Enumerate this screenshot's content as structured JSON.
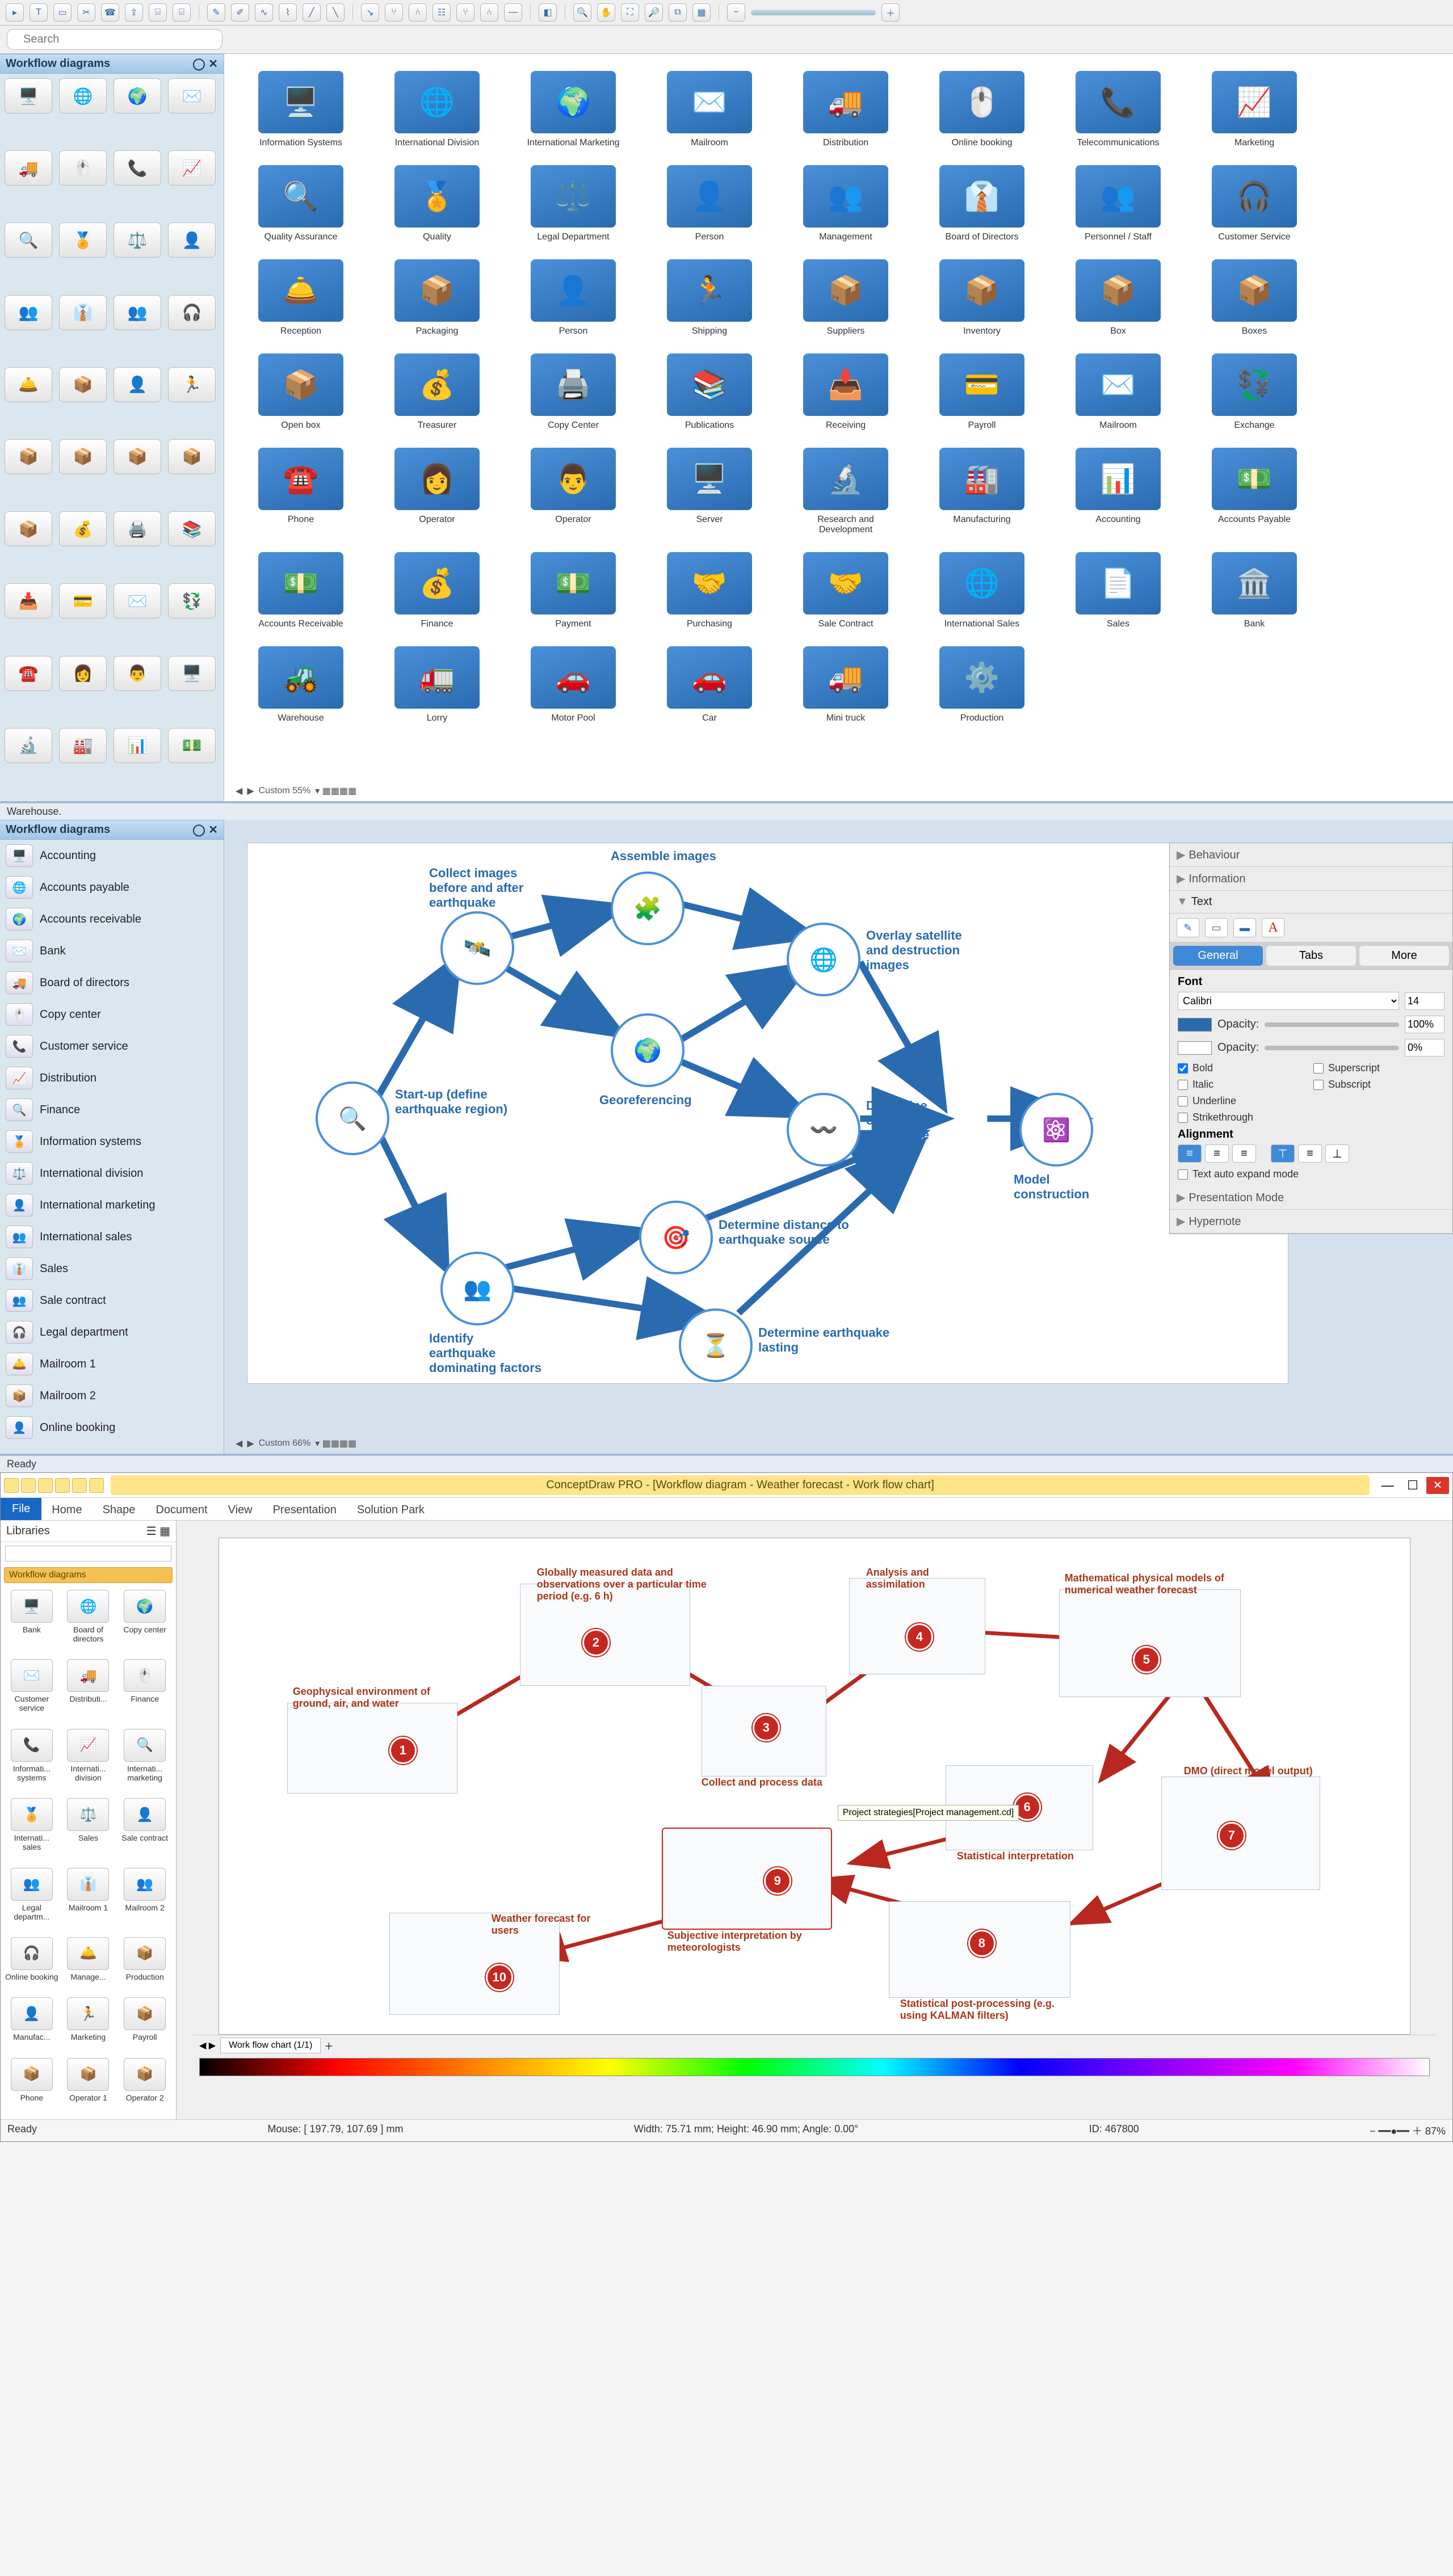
{
  "toolbar_top": {
    "icons": [
      "pointer",
      "hand",
      "text",
      "link",
      "image",
      "crop",
      "phone",
      "share",
      "db",
      "db2",
      "draw",
      "pen",
      "curve",
      "poly",
      "poly2",
      "poly3",
      "connect",
      "branch",
      "split",
      "net",
      "split2",
      "branch2",
      "line",
      "color",
      "zoom-in",
      "zoom-out",
      "fit",
      "search",
      "copy",
      "group",
      "grid",
      "zoom-slider",
      "100"
    ]
  },
  "panel1": {
    "search_placeholder": "Search",
    "palette_title": "Workflow diagrams",
    "shapes": [
      "Information Systems",
      "International Division",
      "International Marketing",
      "Mailroom",
      "Distribution",
      "Online booking",
      "Telecommunications",
      "Marketing",
      "Quality Assurance",
      "Quality",
      "Legal Department",
      "Person",
      "Management",
      "Board of Directors",
      "Personnel / Staff",
      "Customer Service",
      "Reception",
      "Packaging",
      "Person",
      "Shipping",
      "Suppliers",
      "Inventory",
      "Box",
      "Boxes",
      "Open box",
      "Treasurer",
      "Copy Center",
      "Publications",
      "Receiving",
      "Payroll",
      "Mailroom",
      "Exchange",
      "Phone",
      "Operator",
      "Operator",
      "Server",
      "Research and Development",
      "Manufacturing",
      "Accounting",
      "Accounts Payable",
      "Accounts Receivable",
      "Finance",
      "Payment",
      "Purchasing",
      "Sale Contract",
      "International Sales",
      "Sales",
      "Bank",
      "Warehouse",
      "Lorry",
      "Motor Pool",
      "Car",
      "Mini truck",
      "Production"
    ],
    "zoom": "Custom 55%",
    "status": "Warehouse."
  },
  "panel2": {
    "palette_title": "Workflow diagrams",
    "list": [
      "Accounting",
      "Accounts payable",
      "Accounts receivable",
      "Bank",
      "Board of directors",
      "Copy center",
      "Customer service",
      "Distribution",
      "Finance",
      "Information systems",
      "International division",
      "International marketing",
      "International sales",
      "Sales",
      "Sale contract",
      "Legal department",
      "Mailroom 1",
      "Mailroom 2",
      "Online booking"
    ],
    "nodes": {
      "n1": "Collect images before and after earthquake",
      "n2": "Assemble images",
      "n3": "Overlay satellite and destruction images",
      "n4": "Georeferencing",
      "n5": "Start-up (define earthquake region)",
      "n6": "Determine earthquake magnitude",
      "n7": "Model construction",
      "n8": "Identify earthquake dominating factors",
      "n9": "Determine distance to earthquake source",
      "n10": "Determine earthquake lasting"
    },
    "inspector": {
      "sections": [
        "Behaviour",
        "Information",
        "Text"
      ],
      "tabs": [
        "General",
        "Tabs",
        "More"
      ],
      "font_label": "Font",
      "font": "Calibri",
      "font_size": "14",
      "opacity_label": "Opacity:",
      "opacity_fill": "100%",
      "opacity_line": "0%",
      "checks": {
        "bold": "Bold",
        "italic": "Italic",
        "underline": "Underline",
        "strike": "Strikethrough",
        "sup": "Superscript",
        "sub": "Subscript"
      },
      "alignment_label": "Alignment",
      "autoexpand": "Text auto expand mode",
      "presmode": "Presentation Mode",
      "hypernote": "Hypernote"
    },
    "zoom": "Custom 66%",
    "status": "Ready"
  },
  "panel3": {
    "window_title": "ConceptDraw PRO - [Workflow diagram - Weather forecast - Work flow chart]",
    "file_tab": "File",
    "ribbon": [
      "Home",
      "Shape",
      "Document",
      "View",
      "Presentation",
      "Solution Park"
    ],
    "libraries_label": "Libraries",
    "lib_tab": "Workflow diagrams",
    "lib_items": [
      "Bank",
      "Board of directors",
      "Copy center",
      "Customer service",
      "Distributi...",
      "Finance",
      "Informati... systems",
      "Internati... division",
      "Internati... marketing",
      "Internati... sales",
      "Sales",
      "Sale contract",
      "Legal departm...",
      "Mailroom 1",
      "Mailroom 2",
      "Online booking",
      "Manage...",
      "Production",
      "Manufac...",
      "Marketing",
      "Payroll",
      "Phone",
      "Operator 1",
      "Operator 2"
    ],
    "nodes": {
      "n1": {
        "num": "1",
        "label": "Geophysical environment of ground, air, and water"
      },
      "n2": {
        "num": "2",
        "label": "Globally measured data and observations over a particular time period (e.g. 6 h)"
      },
      "n3": {
        "num": "3",
        "label": "Collect and process data"
      },
      "n4": {
        "num": "4",
        "label": "Analysis and assimilation"
      },
      "n5": {
        "num": "5",
        "label": "Mathematical physical models of numerical weather forecast"
      },
      "n6": {
        "num": "6",
        "label": "Statistical interpretation"
      },
      "n7": {
        "num": "7",
        "label": "DMO (direct model output)"
      },
      "n8": {
        "num": "8",
        "label": "Statistical post-processing (e.g. using KALMAN filters)"
      },
      "n9": {
        "num": "9",
        "label": "Subjective interpretation by meteorologists"
      },
      "n10": {
        "num": "10",
        "label": "Weather forecast for users"
      },
      "tooltip": "Project strategies[Project management.cd]"
    },
    "sheet_tab": "Work flow chart (1/1)",
    "status_left": "Ready",
    "status_mouse": "Mouse: [ 197.79, 107.69 ] mm",
    "status_dims": "Width: 75.71 mm;   Height: 46.90 mm;   Angle: 0.00°",
    "status_id": "ID: 467800",
    "status_zoom": "87%"
  }
}
